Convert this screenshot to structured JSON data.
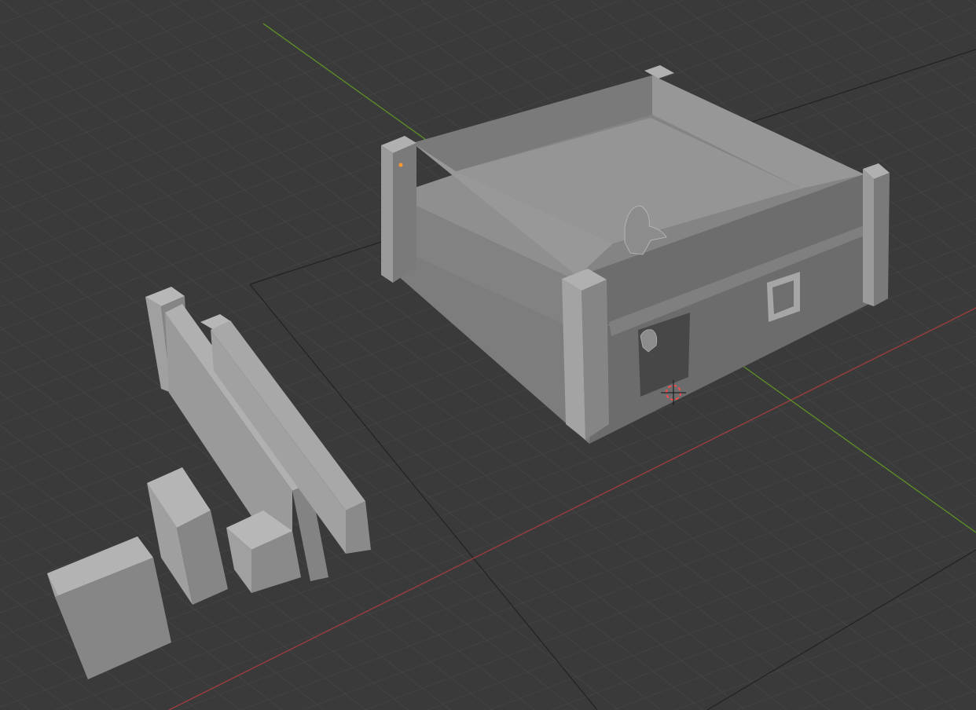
{
  "app": "3D viewport",
  "viewport": {
    "background": "#3a3a3a",
    "grid_color": "#4a4a4a",
    "x_axis_color": "#9c3d3d",
    "y_axis_color": "#5c8a2a"
  },
  "scene": {
    "objects": [
      "house-model",
      "tall-wall-panel",
      "long-wall-panel",
      "small-pillar-block",
      "short-pillar-block",
      "large-block"
    ],
    "figure": "miniature-figure",
    "cursor_icon": "3d-cursor-icon",
    "origin_icon": "object-origin-icon"
  }
}
